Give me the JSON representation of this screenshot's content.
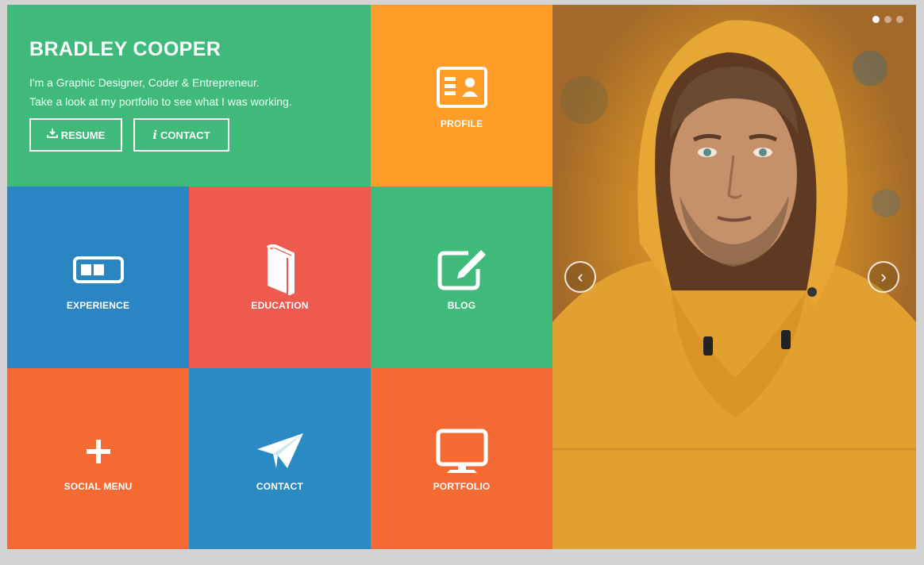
{
  "hero": {
    "name": "BRADLEY COOPER",
    "line1": "I'm a Graphic Designer, Coder & Entrepreneur.",
    "line2": "Take a look at my portfolio to see what I was working.",
    "resume_button": "RESUME",
    "resume_icon": "download-icon",
    "contact_button": "CONTACT",
    "contact_icon": "info-icon"
  },
  "tiles": {
    "profile": {
      "label": "PROFILE",
      "icon": "id-card-icon",
      "color": "#fd9d27"
    },
    "experience": {
      "label": "EXPERIENCE",
      "icon": "briefcase-toggle-icon",
      "color": "#2a86c3"
    },
    "education": {
      "label": "EDUCATION",
      "icon": "book-icon",
      "color": "#ef5a4f"
    },
    "blog": {
      "label": "BLOG",
      "icon": "edit-icon",
      "color": "#3fba7a"
    },
    "social": {
      "label": "SOCIAL MENU",
      "icon": "plus-icon",
      "color": "#f56a32"
    },
    "contact": {
      "label": "CONTACT",
      "icon": "paper-plane-icon",
      "color": "#2a8bc4"
    },
    "portfolio": {
      "label": "PORTFOLIO",
      "icon": "monitor-icon",
      "color": "#f56a32"
    }
  },
  "slider": {
    "prev": "‹",
    "next": "›",
    "dots": 3,
    "active_dot": 1
  },
  "colors": {
    "green": "#3fba7a",
    "orange": "#fd9d27",
    "blue": "#2a86c3",
    "red": "#ef5a4f",
    "deep_orange": "#f56a32"
  }
}
